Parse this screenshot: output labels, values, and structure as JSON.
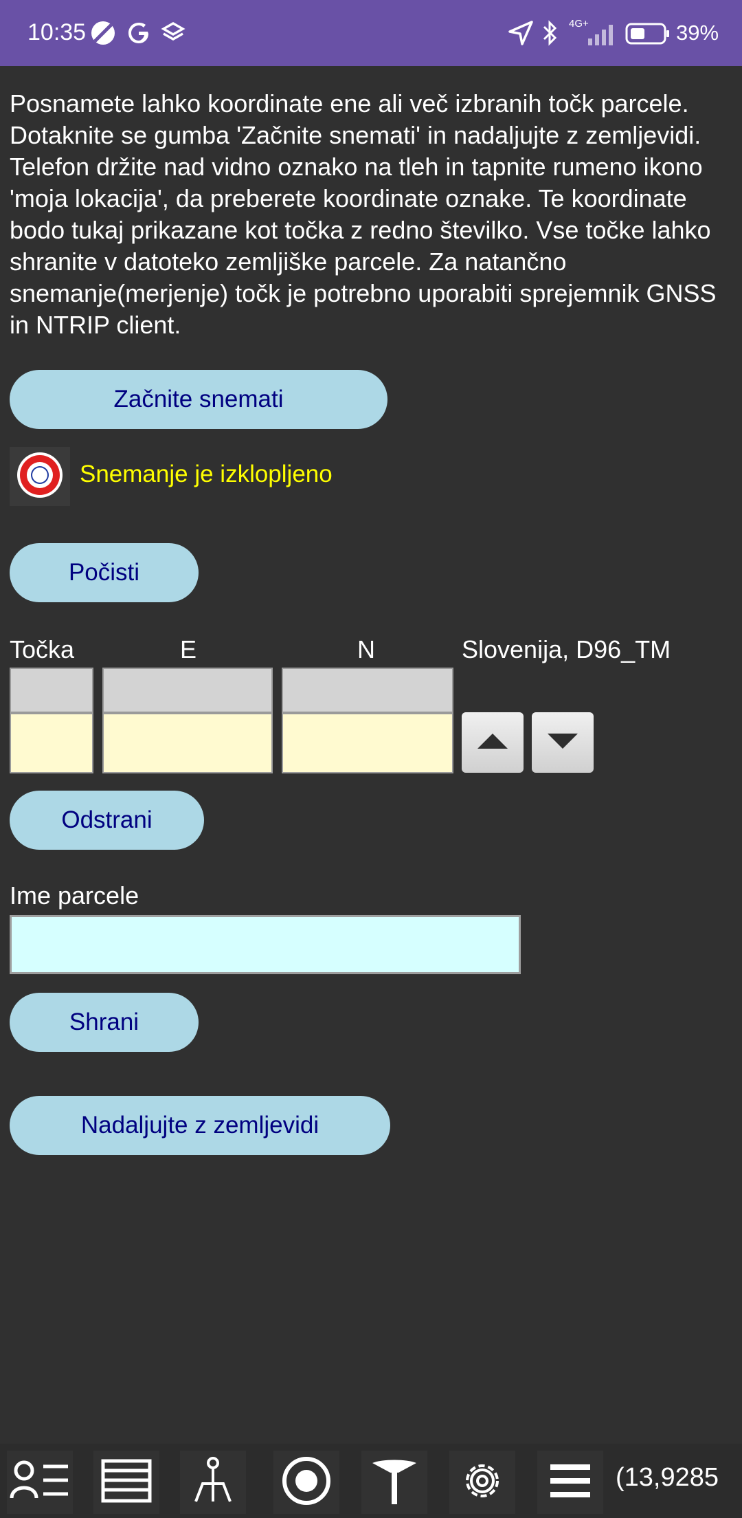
{
  "status_bar": {
    "time": "10:35",
    "network": "4G+",
    "battery": "39%",
    "icons": [
      "moon-icon",
      "google-icon",
      "layers-icon",
      "location-arrow-icon",
      "bluetooth-icon",
      "signal-icon",
      "battery-icon"
    ]
  },
  "intro_text": "Posnamete lahko koordinate ene ali več izbranih točk parcele. Dotaknite se gumba 'Začnite snemati' in nadaljujte z zemljevidi. Telefon držite nad vidno oznako na tleh in tapnite rumeno ikono 'moja lokacija', da preberete koordinate oznake. Te koordinate bodo tukaj prikazane kot točka z redno številko. Vse točke lahko shranite v datoteko zemljiške parcele. Za natančno snemanje(merjenje) točk je potrebno uporabiti sprejemnik GNSS in NTRIP client.",
  "buttons": {
    "start_recording": "Začnite snemati",
    "clear": "Počisti",
    "remove": "Odstrani",
    "save": "Shrani",
    "continue_maps": "Nadaljujte z zemljevidi"
  },
  "recording_status": "Snemanje je izklopljeno",
  "table": {
    "col_point": "Točka",
    "col_e": "E",
    "col_n": "N",
    "crs": "Slovenija, D96_TM"
  },
  "parcel": {
    "label": "Ime parcele",
    "value": ""
  },
  "toolbar": {
    "coordinate": "(13,9285",
    "icons": [
      "list-icon",
      "layers-list-icon",
      "survey-point-icon",
      "record-icon",
      "tripod-icon",
      "gear-icon",
      "menu-icon"
    ]
  },
  "colors": {
    "status_bar": "#6951a6",
    "background": "#303030",
    "button_bg": "#add8e6",
    "button_text": "#000080",
    "status_text": "#ffff00"
  }
}
